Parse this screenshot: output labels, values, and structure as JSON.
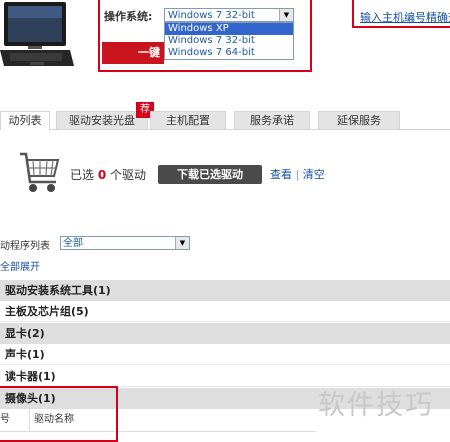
{
  "product": {
    "os_label": "操作系统:",
    "os_selected": "Windows 7 32-bit",
    "os_options": [
      "Windows XP",
      "Windows 7 32-bit",
      "Windows 7 64-bit"
    ],
    "red_button_label": "一键",
    "serial_link": "输入主机编号精确查"
  },
  "tabs": [
    {
      "label": "动列表",
      "active": true
    },
    {
      "label": "驱动安装光盘",
      "badge": "荐"
    },
    {
      "label": "主机配置"
    },
    {
      "label": "服务承诺"
    },
    {
      "label": "延保服务"
    }
  ],
  "cart": {
    "prefix": "已选",
    "count": "0",
    "suffix": "个驱动",
    "download_button": "下载已选驱动",
    "view_link": "查看",
    "separator": "|",
    "clear_link": "清空"
  },
  "filters": {
    "list_label": "动程序列表",
    "list_selected": "全部",
    "expand_all": "全部展开"
  },
  "categories": [
    "驱动安装系统工具(1)",
    "主板及芯片组(5)",
    "显卡(2)",
    "声卡(1)",
    "读卡器(1)",
    "摄像头(1)"
  ],
  "table_header": {
    "col1": "号",
    "col2": "驱动名称"
  },
  "watermark": "软件技巧",
  "colors": {
    "accent_red": "#d7001a",
    "link_blue": "#1a4fa0"
  }
}
